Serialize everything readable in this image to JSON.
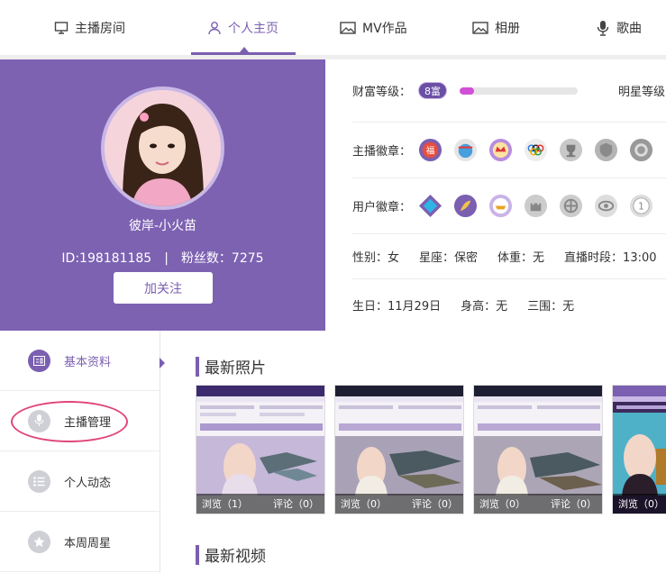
{
  "nav": {
    "tabs": [
      {
        "label": "主播房间",
        "icon": "monitor-icon"
      },
      {
        "label": "个人主页",
        "icon": "user-icon",
        "active": true
      },
      {
        "label": "MV作品",
        "icon": "image-icon"
      },
      {
        "label": "相册",
        "icon": "image-icon"
      },
      {
        "label": "歌曲",
        "icon": "microphone-icon"
      }
    ]
  },
  "profile": {
    "username": "彼岸-小火苗",
    "id_text": "ID:198181185",
    "separator": "|",
    "fans_text": "粉丝数：7275",
    "follow_label": "加关注"
  },
  "info": {
    "wealth_label": "财富等级：",
    "wealth_badge": "8富",
    "wealth_progress": 0.12,
    "star_label": "明星等级",
    "anchor_medal_label": "主播徽章：",
    "user_medal_label": "用户徽章：",
    "gender": "性别：女",
    "constellation": "星座：保密",
    "weight": "体重：无",
    "live_time": "直播时段：13:00",
    "birthday": "生日：11月29日",
    "height": "身高：无",
    "measurements": "三围：无"
  },
  "menu": {
    "items": [
      {
        "label": "基本资料",
        "icon": "profile-card-icon",
        "active": true
      },
      {
        "label": "主播管理",
        "icon": "microphone-icon"
      },
      {
        "label": "个人动态",
        "icon": "list-icon"
      },
      {
        "label": "本周周星",
        "icon": "star-icon"
      }
    ]
  },
  "content": {
    "photos_title": "最新照片",
    "videos_title": "最新视频",
    "photos": [
      {
        "views": "浏览（1）",
        "comments": "评论（0）"
      },
      {
        "views": "浏览（0）",
        "comments": "评论（0）"
      },
      {
        "views": "浏览（0）",
        "comments": "评论（0）"
      },
      {
        "views": "浏览（0）",
        "comments": ""
      }
    ]
  },
  "colors": {
    "accent": "#7b5fb0",
    "profile_bg": "#7d62b2",
    "progress_fill": "#d24ed6",
    "highlight": "#e0457a"
  }
}
